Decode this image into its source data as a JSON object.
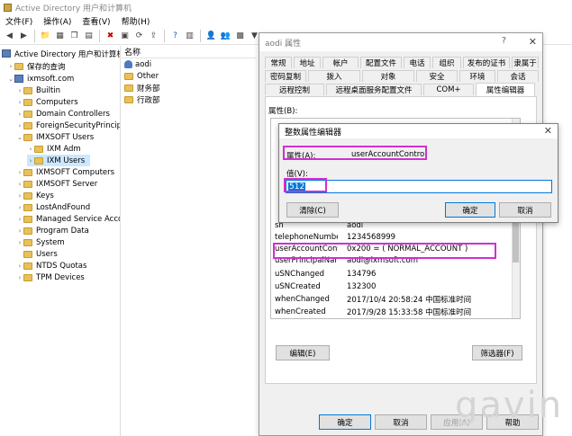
{
  "window": {
    "title": "Active Directory 用户和计算机"
  },
  "menu": [
    "文件(F)",
    "操作(A)",
    "查看(V)",
    "帮助(H)"
  ],
  "tree": {
    "root": "Active Directory 用户和计算机",
    "saved_queries": "保存的查询",
    "domain": "ixmsoft.com",
    "items": [
      "Builtin",
      "Computers",
      "Domain Controllers",
      "ForeignSecurityPrincipals",
      "IMXSOFT Users",
      "IXM Adm",
      "IXM Users",
      "IXMSOFT Computers",
      "IXMSOFT Server",
      "Keys",
      "LostAndFound",
      "Managed Service Accounts",
      "Program Data",
      "System",
      "Users",
      "NTDS Quotas",
      "TPM Devices"
    ]
  },
  "list": {
    "header": "名称",
    "items": [
      "aodi",
      "Other",
      "财务部",
      "行政部"
    ]
  },
  "props": {
    "title": "aodi 属性",
    "tabs_row1": [
      "常规",
      "地址",
      "帐户",
      "配置文件",
      "电话",
      "组织",
      "发布的证书",
      "隶属于"
    ],
    "tabs_row2": [
      "密码复制",
      "拨入",
      "对象",
      "安全",
      "环境",
      "会话"
    ],
    "tabs_row3": [
      "远程控制",
      "远程桌面服务配置文件",
      "COM+",
      "属性编辑器"
    ],
    "attr_label": "属性(B):",
    "attributes": [
      {
        "k": "sn",
        "v": "aodi"
      },
      {
        "k": "telephoneNumber",
        "v": "1234568999"
      },
      {
        "k": "userAccountContr...",
        "v": "0x200 = ( NORMAL_ACCOUNT )"
      },
      {
        "k": "userPrincipalName",
        "v": "aodi@ixmsoft.com"
      },
      {
        "k": "uSNChanged",
        "v": "134796"
      },
      {
        "k": "uSNCreated",
        "v": "132300"
      },
      {
        "k": "whenChanged",
        "v": "2017/10/4 20:58:24 中国标准时间"
      },
      {
        "k": "whenCreated",
        "v": "2017/9/28 15:33:58 中国标准时间"
      }
    ],
    "edit_btn": "编辑(E)",
    "filter_btn": "筛选器(F)",
    "ok": "确定",
    "cancel": "取消",
    "apply": "应用(A)",
    "help": "帮助"
  },
  "int_editor": {
    "title": "整数属性编辑器",
    "attr_label": "属性(A):",
    "attr_value": "userAccountControl",
    "value_label": "值(V):",
    "value": "512",
    "clear_btn": "清除(C)",
    "ok": "确定",
    "cancel": "取消"
  },
  "watermark": "gavin",
  "colors": {
    "highlight": "#d22ed2",
    "accent": "#0078d7"
  }
}
